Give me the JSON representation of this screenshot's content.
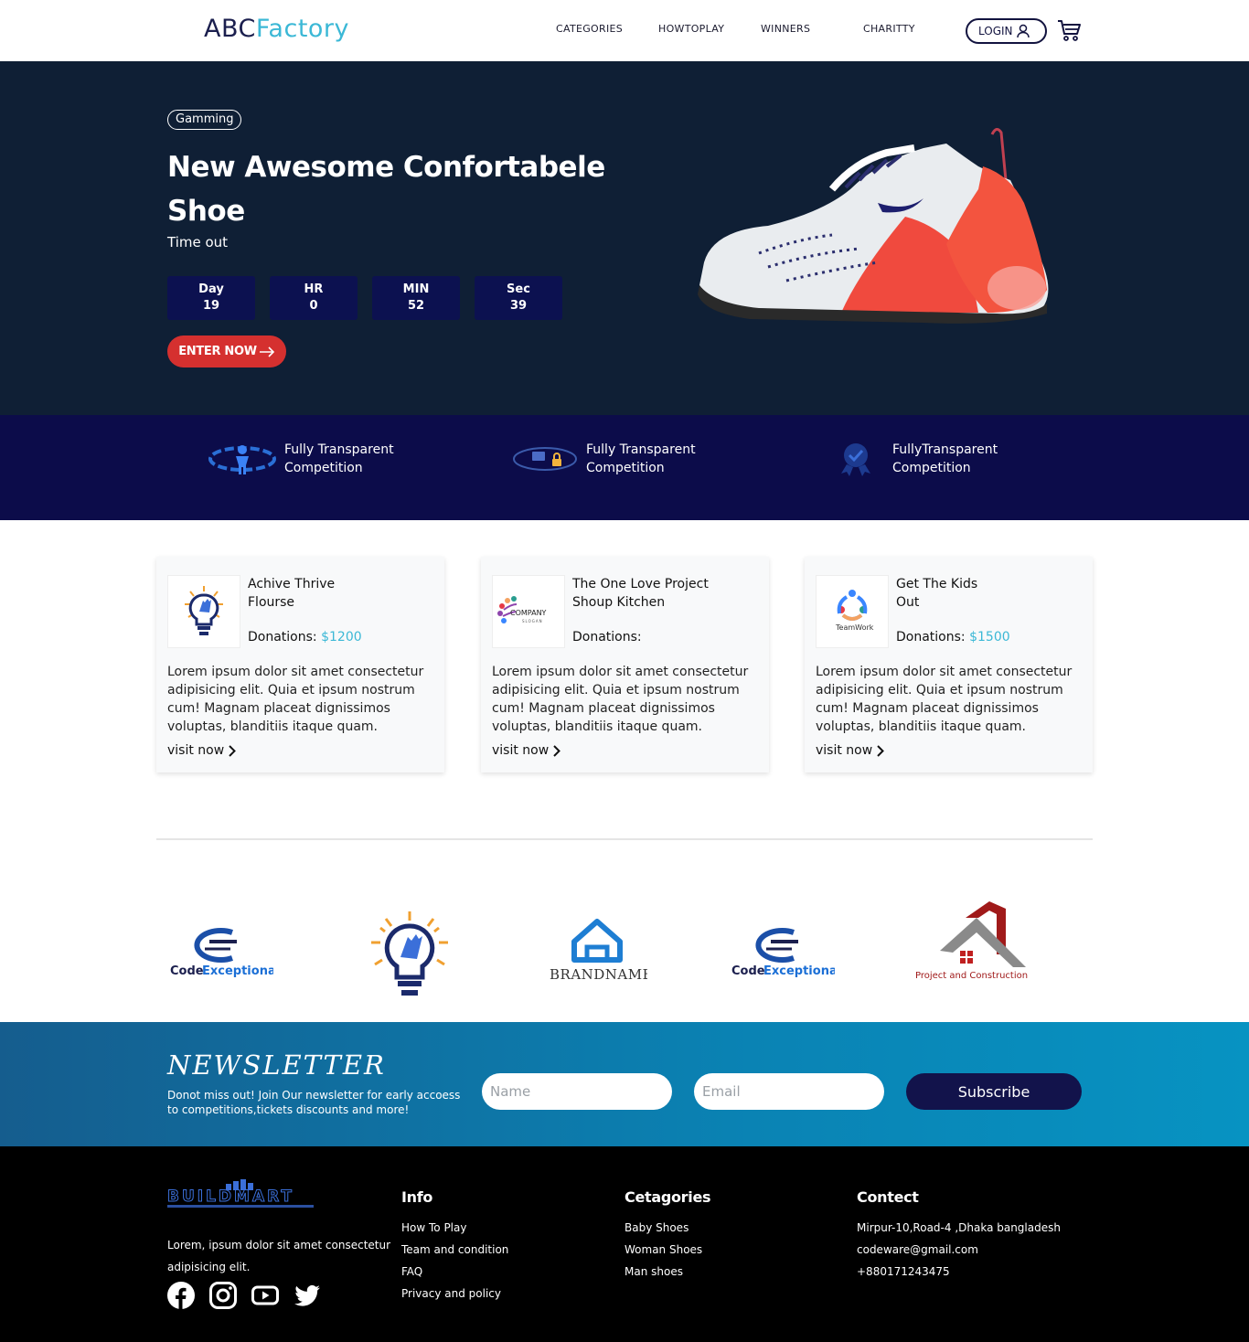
{
  "header": {
    "logo_part1": "ABC",
    "logo_part2": "Factory",
    "nav": [
      "CATEGORIES",
      "HOWTOPLAY",
      "WINNERS",
      "CHARITTY"
    ],
    "login_label": "LOGIN"
  },
  "hero": {
    "badge": "Gamming",
    "title": "New Awesome Confortabele Shoe",
    "timeout_label": "Time out",
    "countdown": [
      {
        "label": "Day",
        "value": "19"
      },
      {
        "label": "HR",
        "value": "0"
      },
      {
        "label": "MIN",
        "value": "52"
      },
      {
        "label": "Sec",
        "value": "39"
      }
    ],
    "cta_label": "ENTER NOW"
  },
  "features": [
    {
      "line1": "Fully Transparent",
      "line2": "Competition"
    },
    {
      "line1": "Fully Transparent",
      "line2": "Competition"
    },
    {
      "line1": "FullyTransparent",
      "line2": "Competition"
    }
  ],
  "cards": [
    {
      "title_line1": "Achive Thrive",
      "title_line2": "Flourse",
      "donations_label": "Donations:",
      "amount": "$1200",
      "desc": "Lorem ipsum dolor sit amet consectetur adipisicing elit. Quia et ipsum nostrum cum! Magnam placeat dignissimos voluptas, blanditiis itaque quam.",
      "link": "visit now"
    },
    {
      "title_line1": "The One Love Project",
      "title_line2": "Shoup Kitchen",
      "donations_label": "Donations:",
      "amount": "",
      "logo_text1": "COMPANY",
      "logo_text2": "SLOGAN",
      "desc": "Lorem ipsum dolor sit amet consectetur adipisicing elit. Quia et ipsum nostrum cum! Magnam placeat dignissimos voluptas, blanditiis itaque quam.",
      "link": "visit now"
    },
    {
      "title_line1": "Get The Kids",
      "title_line2": "Out",
      "donations_label": "Donations:",
      "amount": "$1500",
      "logo_text1": "TeamWork",
      "desc": "Lorem ipsum dolor sit amet consectetur adipisicing elit. Quia et ipsum nostrum cum! Magnam placeat dignissimos voluptas, blanditiis itaque quam.",
      "link": "visit now"
    }
  ],
  "sponsors": {
    "code_exceptional_1": "Code",
    "code_exceptional_2": "Exceptional",
    "brandname": "BRANDNAME",
    "project": "Project and Construction"
  },
  "newsletter": {
    "title": "NEWSLETTER",
    "text": "Donot miss out! Join Our newsletter for early accoess to competitions,tickets discounts and more!",
    "name_placeholder": "Name",
    "email_placeholder": "Email",
    "button": "Subscribe"
  },
  "footer": {
    "brand": "BUILDMART",
    "about": "Lorem, ipsum dolor sit amet consectetur adipisicing elit.",
    "info": {
      "title": "Info",
      "items": [
        "How To Play",
        "Team and condition",
        "FAQ",
        "Privacy and policy"
      ]
    },
    "categories": {
      "title": "Cetagories",
      "items": [
        "Baby Shoes",
        "Woman Shoes",
        "Man shoes"
      ]
    },
    "contact": {
      "title": "Contect",
      "items": [
        "Mirpur-10,Road-4 ,Dhaka bangladesh",
        "codeware@gmail.com",
        "+880171243475"
      ]
    }
  },
  "colors": {
    "hero_bg": "#0f1f35",
    "feature_bg": "#0c0c4a",
    "accent_cyan": "#3bb8d6",
    "cta_red": "#d5302f",
    "countdown_bg": "#0c1150"
  }
}
